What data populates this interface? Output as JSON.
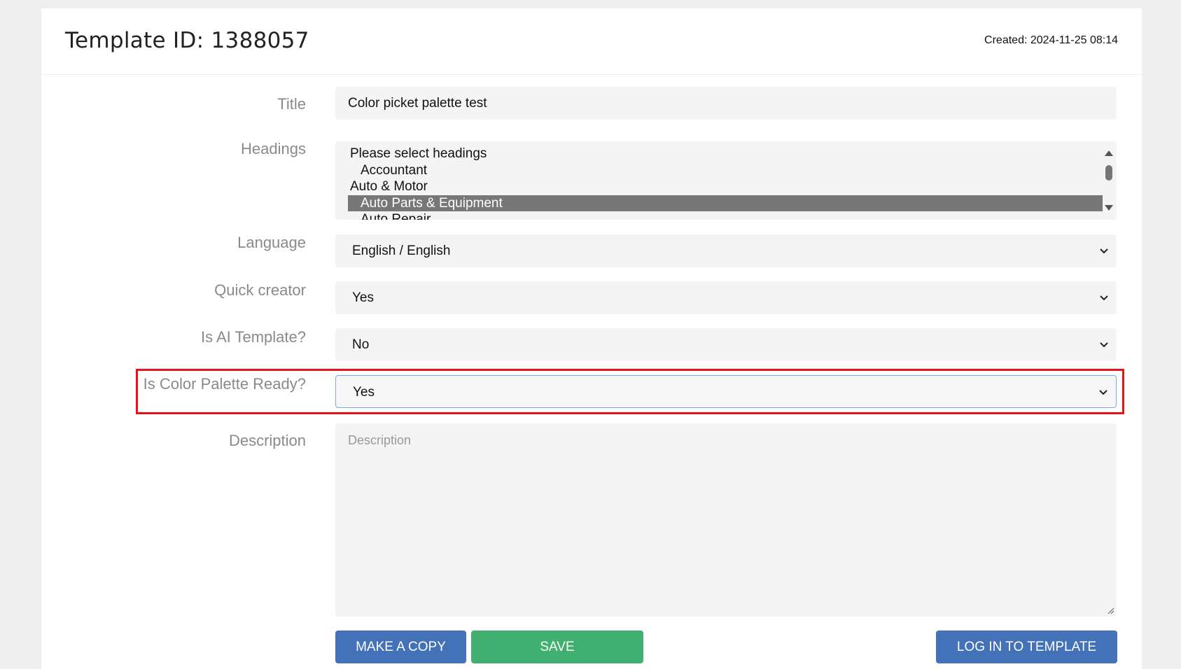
{
  "header": {
    "template_title": "Template ID: 1388057",
    "created": "Created: 2024-11-25 08:14"
  },
  "form": {
    "title": {
      "label": "Title",
      "value": "Color picket palette test"
    },
    "headings": {
      "label": "Headings",
      "options": [
        "Please select headings",
        "Accountant",
        "Auto & Motor",
        "Auto Parts & Equipment",
        "Auto Repair"
      ],
      "selected": "Auto Parts & Equipment"
    },
    "language": {
      "label": "Language",
      "value": "English / English"
    },
    "quick_creator": {
      "label": "Quick creator",
      "value": "Yes"
    },
    "is_ai_template": {
      "label": "Is AI Template?",
      "value": "No"
    },
    "is_color_palette_ready": {
      "label": "Is Color Palette Ready?",
      "value": "Yes"
    },
    "description": {
      "label": "Description",
      "placeholder": "Description"
    }
  },
  "buttons": {
    "make_copy": "MAKE A COPY",
    "save": "SAVE",
    "log_in": "LOG IN TO TEMPLATE"
  },
  "colors": {
    "highlight": "#e5141c",
    "primary_button": "#4472b8",
    "save_button": "#40b070",
    "selected_option": "#777777"
  }
}
